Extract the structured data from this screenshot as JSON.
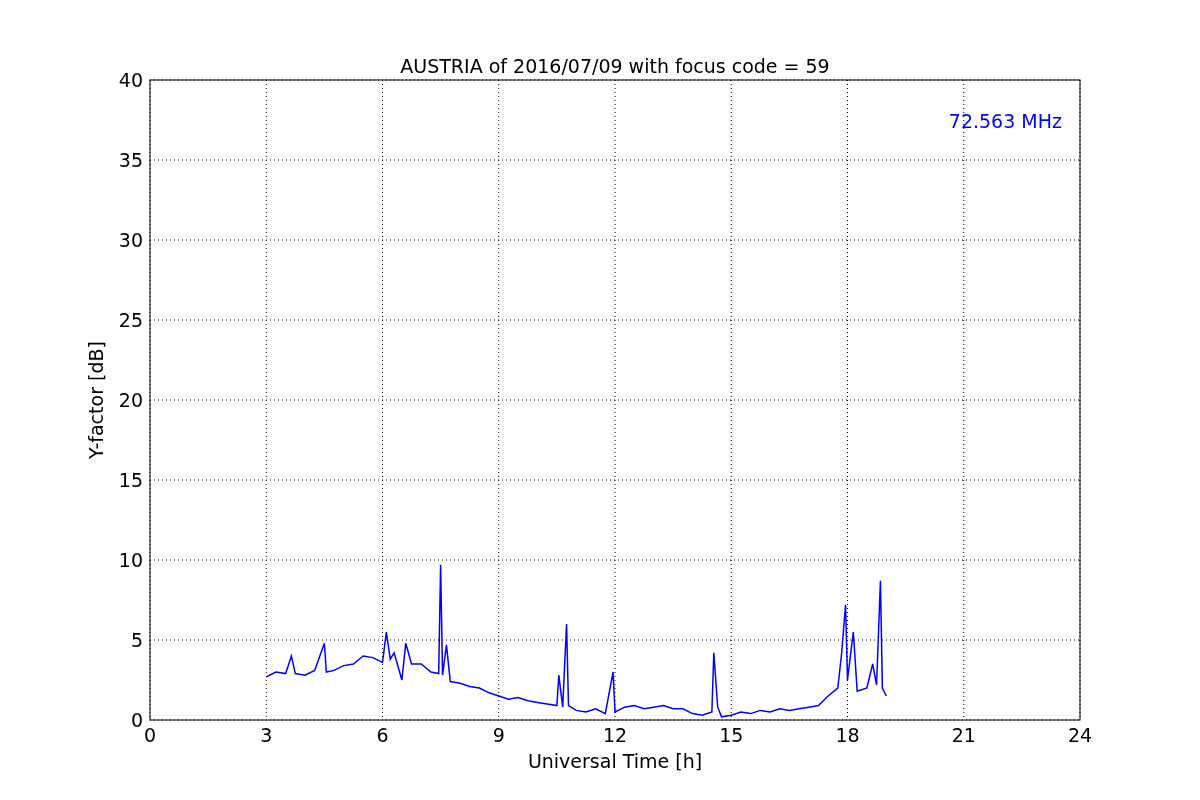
{
  "figure": {
    "chart_data": {
      "type": "line",
      "title": "AUSTRIA of 2016/07/09 with focus code = 59",
      "xlabel": "Universal Time [h]",
      "ylabel": "Y-factor [dB]",
      "x": [
        3.0,
        3.25,
        3.5,
        3.65,
        3.75,
        4.0,
        4.25,
        4.5,
        4.55,
        4.75,
        5.0,
        5.25,
        5.5,
        5.75,
        6.0,
        6.1,
        6.2,
        6.3,
        6.5,
        6.6,
        6.75,
        7.0,
        7.25,
        7.45,
        7.5,
        7.55,
        7.65,
        7.75,
        8.0,
        8.25,
        8.5,
        8.75,
        9.0,
        9.25,
        9.5,
        9.75,
        10.0,
        10.25,
        10.5,
        10.55,
        10.65,
        10.75,
        10.8,
        11.0,
        11.25,
        11.5,
        11.75,
        11.95,
        12.0,
        12.25,
        12.5,
        12.75,
        13.0,
        13.25,
        13.5,
        13.75,
        14.0,
        14.25,
        14.5,
        14.55,
        14.65,
        14.75,
        15.0,
        15.25,
        15.5,
        15.75,
        16.0,
        16.25,
        16.5,
        16.75,
        17.0,
        17.25,
        17.5,
        17.75,
        17.85,
        17.95,
        18.0,
        18.15,
        18.25,
        18.5,
        18.65,
        18.75,
        18.85,
        18.9,
        19.0
      ],
      "series": [
        {
          "name": "72.563 MHz",
          "color": "#0000ff",
          "values": [
            2.7,
            3.0,
            2.9,
            4.0,
            2.9,
            2.8,
            3.1,
            4.8,
            3.0,
            3.1,
            3.4,
            3.5,
            4.0,
            3.9,
            3.6,
            5.5,
            3.8,
            4.2,
            2.5,
            4.8,
            3.5,
            3.5,
            3.0,
            2.9,
            9.7,
            2.8,
            4.7,
            2.4,
            2.3,
            2.1,
            2.0,
            1.7,
            1.5,
            1.3,
            1.4,
            1.2,
            1.1,
            1.0,
            0.9,
            2.8,
            0.8,
            6.0,
            0.9,
            0.6,
            0.5,
            0.7,
            0.4,
            3.0,
            0.5,
            0.8,
            0.9,
            0.7,
            0.8,
            0.9,
            0.7,
            0.7,
            0.4,
            0.3,
            0.5,
            4.2,
            0.8,
            0.2,
            0.3,
            0.5,
            0.4,
            0.6,
            0.5,
            0.7,
            0.6,
            0.7,
            0.8,
            0.9,
            1.5,
            2.0,
            4.2,
            7.2,
            2.5,
            5.5,
            1.8,
            2.0,
            3.5,
            2.2,
            8.7,
            2.0,
            1.5
          ]
        }
      ],
      "xlim": [
        0,
        24
      ],
      "ylim": [
        0,
        40
      ],
      "xticks": [
        0,
        3,
        6,
        9,
        12,
        15,
        18,
        21,
        24
      ],
      "yticks": [
        0,
        5,
        10,
        15,
        20,
        25,
        30,
        35,
        40
      ],
      "grid": true
    }
  }
}
